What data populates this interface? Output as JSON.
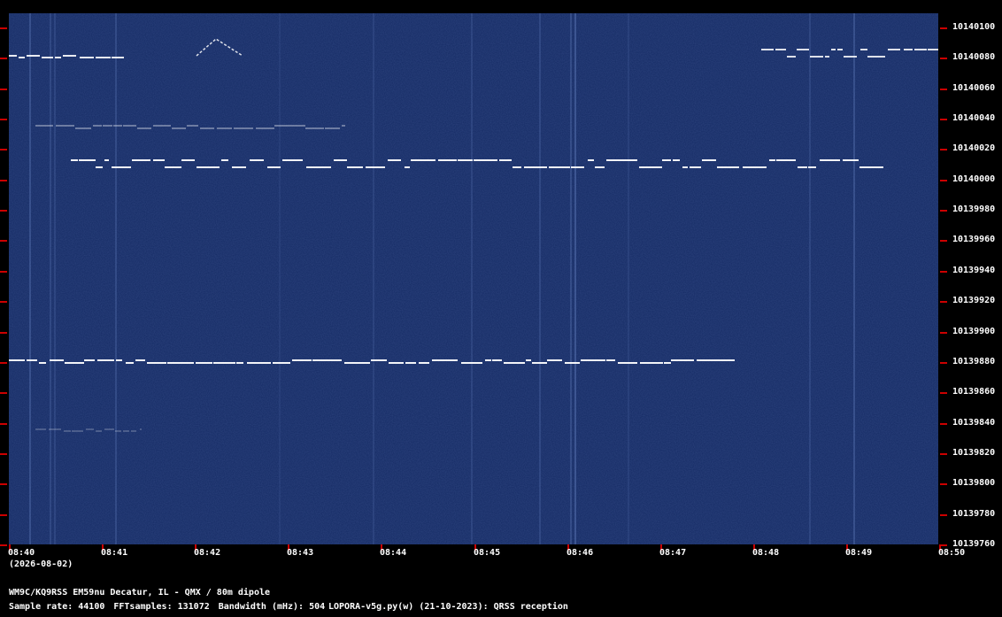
{
  "colors": {
    "background": "#000000",
    "waterfall": "#142a63",
    "signal": "#ffffff",
    "tick": "#cc0000",
    "text": "#ffffff"
  },
  "frequency_axis": {
    "labels": [
      "10140100",
      "10140080",
      "10140060",
      "10140040",
      "10140020",
      "10140000",
      "10139980",
      "10139960",
      "10139940",
      "10139920",
      "10139900",
      "10139880",
      "10139860",
      "10139840",
      "10139820",
      "10139800",
      "10139780",
      "10139760"
    ]
  },
  "time_axis": {
    "labels": [
      "08:40",
      "08:41",
      "08:42",
      "08:43",
      "08:44",
      "08:45",
      "08:46",
      "08:47",
      "08:48",
      "08:49",
      "08:50"
    ],
    "date": "(2026-08-02)"
  },
  "info": {
    "station": "WM9C/KQ9RSS EM59nu Decatur, IL - QMX / 80m dipole",
    "sample_rate": "Sample rate: 44100",
    "fft_samples": "FFTsamples: 131072",
    "bandwidth": "Bandwidth (mHz): 504",
    "software": "LOPORA-v5g.py(w) (21-10-2023): QRSS reception"
  }
}
